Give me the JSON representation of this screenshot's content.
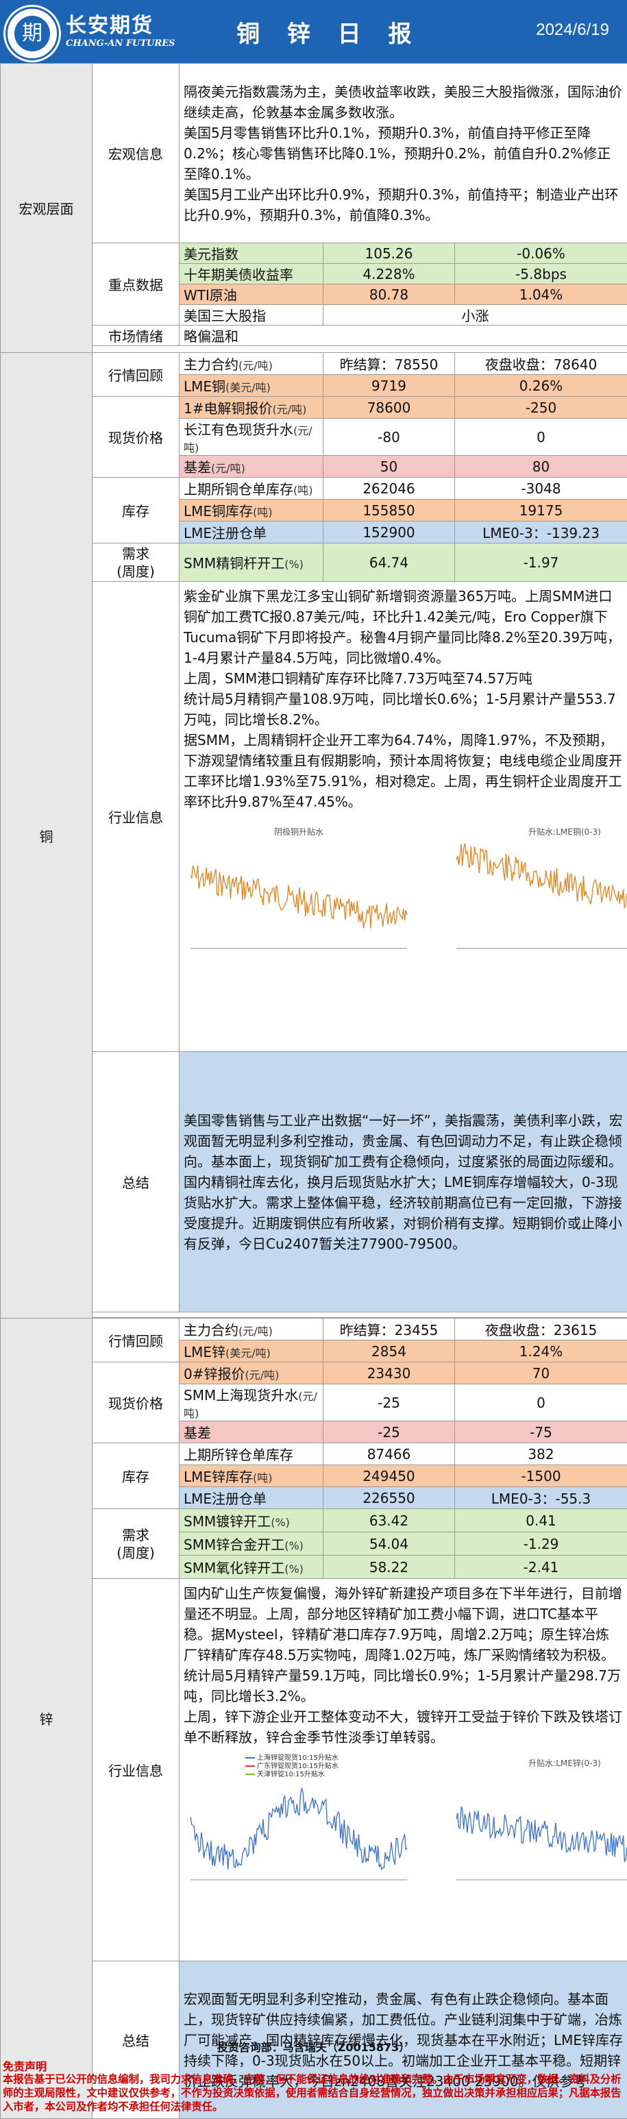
{
  "header": {
    "logo_glyph": "期",
    "company_cn": "长安期货",
    "company_en": "CHANG-AN FUTURES",
    "title": "铜 锌 日 报",
    "date": "2024/6/19"
  },
  "macro": {
    "section": "宏观层面",
    "info_label": "宏观信息",
    "info_lines": [
      "隔夜美元指数震荡为主，美债收益率收跌，美股三大股指微涨，国际油价继续走高，伦敦基本金属多数收涨。",
      "美国5月零售销售环比升0.1%，预期升0.3%，前值自持平修正至降0.2%；核心零售销售环比降0.1%，预期升0.2%，前值自升0.2%修正至降0.1%。",
      "美国5月工业产出环比升0.9%，预期升0.3%，前值持平；制造业产出环比升0.9%，预期升0.3%，前值降0.3%。"
    ],
    "key_label": "重点数据",
    "key_rows": [
      {
        "name": "美元指数",
        "v1": "105.26",
        "v2": "-0.06%"
      },
      {
        "name": "十年期美债收益率",
        "v1": "4.228%",
        "v2": "-5.8bps"
      },
      {
        "name": "WTI原油",
        "v1": "80.78",
        "v2": "1.04%"
      },
      {
        "name": "美国三大股指",
        "v1": "小涨",
        "v2": ""
      }
    ],
    "mood_label": "市场情绪",
    "mood_value": "略偏温和"
  },
  "copper": {
    "section": "铜",
    "market_label": "行情回顾",
    "main_contract": "主力合约",
    "unit_yuan_ton": "(元/吨)",
    "unit_usd_ton": "(美元/吨)",
    "prev_close": "昨结算：78550",
    "night_close": "夜盘收盘：78640",
    "lme_name": "LME铜",
    "lme_v1": "9719",
    "lme_v2": "0.26%",
    "spot_label": "现货价格",
    "spot_rows": [
      {
        "name": "1#电解铜报价",
        "unit": "(元/吨)",
        "v1": "78600",
        "v2": "-250"
      },
      {
        "name": "长江有色现货升水",
        "unit": "(元/吨)",
        "v1": "-80",
        "v2": "0"
      },
      {
        "name": "基差",
        "unit": "(元/吨)",
        "v1": "50",
        "v2": "80"
      }
    ],
    "inv_label": "库存",
    "inv_rows": [
      {
        "name": "上期所铜仓单库存",
        "unit": "(吨)",
        "v1": "262046",
        "v2": "-3048"
      },
      {
        "name": "LME铜库存",
        "unit": "(吨)",
        "v1": "155850",
        "v2": "19175"
      },
      {
        "name": "LME注册仓单",
        "unit": "",
        "v1": "152900",
        "v2": "LME0-3：-139.23"
      }
    ],
    "demand_label": "需求\n(周度)",
    "demand_rows": [
      {
        "name": "SMM精铜杆开工",
        "unit": "(%)",
        "v1": "64.74",
        "v2": "-1.97"
      }
    ],
    "industry_label": "行业信息",
    "industry_lines": [
      "紫金矿业旗下黑龙江多宝山铜矿新增铜资源量365万吨。上周SMM进口铜矿加工费TC报0.87美元/吨，环比升1.42美元/吨，Ero Copper旗下Tucuma铜矿下月即将投产。秘鲁4月铜产量同比降8.2%至20.39万吨，1-4月累计产量84.5万吨，同比微增0.4%。",
      "上周，SMM港口铜精矿库存环比降7.73万吨至74.57万吨",
      "统计局5月精铜产量108.9万吨，同比增长0.6%；1-5月累计产量553.7万吨，同比增长8.2%。",
      "据SMM，上周精铜杆企业开工率为64.74%，周降1.97%，不及预期，下游观望情绪较重且有假期影响，预计本周将恢复；电线电缆企业周度开工率环比增1.93%至75.91%，相对稳定。上周，再生铜杆企业周度开工率环比升9.87%至47.45%。"
    ],
    "chart1_title": "阴极铜升贴水",
    "chart2_title": "升贴水:LME铜(0-3)",
    "summary_label": "总结",
    "summary": "美国零售销售与工业产出数据“一好一坏”，美指震荡，美债利率小跌，宏观面暂无明显利多利空推动，贵金属、有色回调动力不足，有止跌企稳倾向。基本面上，现货铜矿加工费有企稳倾向，过度紧张的局面边际缓和。国内精铜社库去化，换月后现货贴水扩大；LME铜库存增幅较大，0-3现货贴水扩大。需求上整体偏平稳，经济较前期高位已有一定回撤，下游接受度提升。近期废铜供应有所收紧，对铜价稍有支撑。短期铜价或止降小有反弹，今日Cu2407暂关注77900-79500。"
  },
  "zinc": {
    "section": "锌",
    "market_label": "行情回顾",
    "main_contract": "主力合约",
    "unit_yuan_ton": "(元/吨)",
    "unit_usd_ton": "(美元/吨)",
    "prev_close": "昨结算：23455",
    "night_close": "夜盘收盘：23615",
    "lme_name": "LME锌",
    "lme_v1": "2854",
    "lme_v2": "1.24%",
    "spot_label": "现货价格",
    "spot_rows": [
      {
        "name": "0#锌报价",
        "unit": "(元/吨)",
        "v1": "23430",
        "v2": "70"
      },
      {
        "name": "SMM上海现货升水",
        "unit": "(元/吨)",
        "v1": "-25",
        "v2": "0"
      },
      {
        "name": "基差",
        "unit": "",
        "v1": "-25",
        "v2": "-75"
      }
    ],
    "inv_label": "库存",
    "inv_rows": [
      {
        "name": "上期所锌仓单库存",
        "unit": "",
        "v1": "87466",
        "v2": "382"
      },
      {
        "name": "LME锌库存",
        "unit": "(吨)",
        "v1": "249450",
        "v2": "-1500"
      },
      {
        "name": "LME注册仓单",
        "unit": "",
        "v1": "226550",
        "v2": "LME0-3：-55.3"
      }
    ],
    "demand_label": "需求\n(周度)",
    "demand_rows": [
      {
        "name": "SMM镀锌开工",
        "unit": "(%)",
        "v1": "63.42",
        "v2": "0.41"
      },
      {
        "name": "SMM锌合金开工",
        "unit": "(%)",
        "v1": "54.04",
        "v2": "-1.29"
      },
      {
        "name": "SMM氧化锌开工",
        "unit": "(%)",
        "v1": "58.22",
        "v2": "-2.41"
      }
    ],
    "industry_label": "行业信息",
    "industry_lines": [
      "国内矿山生产恢复偏慢，海外锌矿新建投产项目多在下半年进行，目前增量还不明显。上周，部分地区锌精矿加工费小幅下调，进口TC基本平稳。据Mysteel，锌精矿港口库存7.9万吨，周增2.2万吨；原生锌冶炼厂锌精矿库存48.5万实物吨，周降1.02万吨，炼厂采购情绪较为积极。",
      "统计局5月精锌产量59.1万吨，同比增长0.9%；1-5月累计产量298.7万吨，同比增长3.2%。",
      "上周，锌下游企业开工整体变动不大，镀锌开工受益于锌价下跌及铁塔订单不断释放，锌合金季节性淡季订单转弱。"
    ],
    "chart1_legend": [
      "上海锌锭现货10:15升贴水",
      "广东锌锭现货10:15升贴水",
      "天津锌锭10:15升贴水"
    ],
    "chart2_title": "升贴水:LME锌(0-3)",
    "summary_label": "总结",
    "summary": "宏观面暂无明显利多利空推动，贵金属、有色有止跌企稳倾向。基本面上，现货锌矿供应持续偏紧，加工费低位。产业链利润集中于矿端，冶炼厂可能减产。国内精锌库存缓慢去化，现货基本在平水附近；LME锌库存持续下降，0-3现货贴水在50以上。初端加工企业开工基本平稳。短期锌价止跌反弹概率大，今日zn2408暂关注23400-23900。仅供参考"
  },
  "footer": {
    "contact": "投资咨询部：马含瑞夫（Z0015873）",
    "disclaimer_title": "免责声明",
    "disclaimer": "本报告基于已公开的信息编制，我司力求信息准确、完整，但不能保证信息的绝对准确和完整。由于市场瞬息万变，数据、资料及分析师的主观局限性，文中建议仅供参考，不作为投资决策依据，使用者需结合自身经营情况，独立做出决策并承担相应后果；凡据本报告入市者，本公司及作者均不承担任何法律责任。"
  }
}
